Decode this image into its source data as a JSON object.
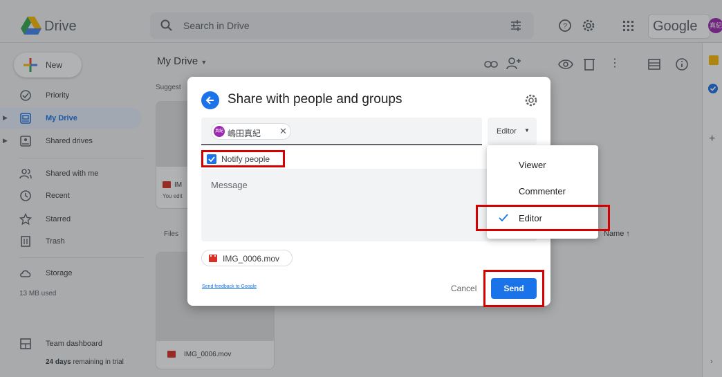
{
  "app": {
    "title": "Drive",
    "brand_word": "Google",
    "avatar_text": "真紀"
  },
  "search": {
    "placeholder": "Search in Drive"
  },
  "sidebar": {
    "new_label": "New",
    "items": [
      {
        "label": "Priority",
        "icon": "priority-icon"
      },
      {
        "label": "My Drive",
        "icon": "my-drive-icon",
        "active": true
      },
      {
        "label": "Shared drives",
        "icon": "shared-drives-icon"
      },
      {
        "label": "Shared with me",
        "icon": "shared-with-me-icon"
      },
      {
        "label": "Recent",
        "icon": "clock-icon"
      },
      {
        "label": "Starred",
        "icon": "star-icon"
      },
      {
        "label": "Trash",
        "icon": "trash-icon"
      },
      {
        "label": "Storage",
        "icon": "cloud-icon"
      }
    ],
    "storage_used": "13 MB used",
    "team_dashboard": "Team dashboard",
    "trial_days": "24 days",
    "trial_suffix": " remaining in trial"
  },
  "main": {
    "title": "My Drive",
    "suggested_label": "Suggest",
    "files_label": "Files",
    "sort_label": "Name",
    "suggested_card": {
      "name": "IM",
      "sub": "You edit"
    },
    "file_card": {
      "name": "IMG_0006.mov"
    }
  },
  "dialog": {
    "title": "Share with people and groups",
    "chip": {
      "avatar": "真紀",
      "name": "嶋田真紀"
    },
    "role": "Editor",
    "notify_label": "Notify people",
    "message_placeholder": "Message",
    "attachment": "IMG_0006.mov",
    "feedback_link": "Send feedback to Google",
    "cancel_label": "Cancel",
    "send_label": "Send"
  },
  "role_menu": {
    "options": [
      {
        "label": "Viewer",
        "checked": false
      },
      {
        "label": "Commenter",
        "checked": false
      },
      {
        "label": "Editor",
        "checked": true
      }
    ]
  },
  "colors": {
    "accent": "#1a73e8",
    "highlight": "#d50000"
  }
}
